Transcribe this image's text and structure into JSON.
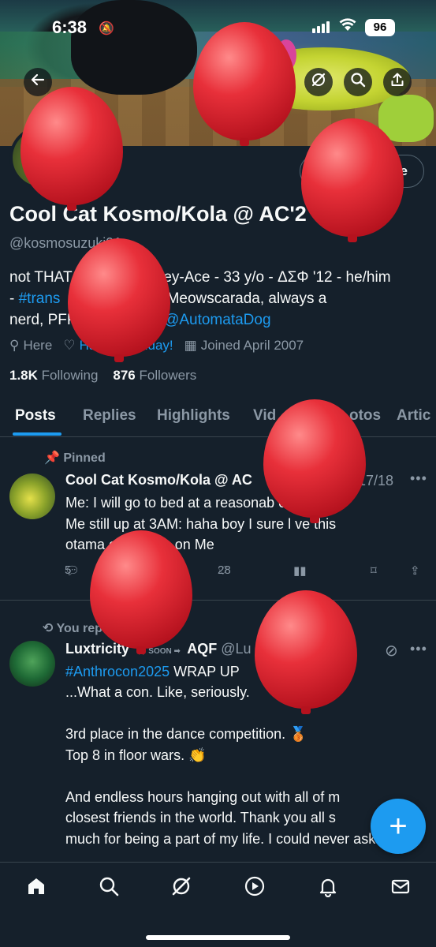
{
  "status_bar": {
    "time": "6:38",
    "battery": "96"
  },
  "header": {},
  "profile": {
    "edit_button_partial": "e",
    "name": "Cool Cat Kosmo/Kola @ AC'2",
    "handle": "@kosmosuzuki91",
    "bio_line1": "not THAT                  Grey-Ace - 33 y/o - ΔΣΦ '12 - he/him",
    "bio_line2_a": "- ",
    "bio_line2_link": "#trans",
    "bio_line2_b": "              imes a Meowscarada, always a",
    "bio_line3_a": "nerd, PFP                   : ",
    "bio_line3_link": "@AutomataDog",
    "location": "Here",
    "website": "Happy birthday!",
    "joined": "Joined April 2007",
    "following_count": "1.8K",
    "following_label": "Following",
    "followers_count": "876",
    "followers_label": "Followers"
  },
  "tabs": [
    "Posts",
    "Replies",
    "Highlights",
    "Vid",
    "otos",
    "Artic"
  ],
  "posts": [
    {
      "pinned_label": "Pinned",
      "author": "Cool Cat Kosmo/Kola @ AC",
      "date": "17/18",
      "text": "Me: I will go to bed at a reasonab        e.\nMe still up at 3AM: haha boy I sure l  ve this\notama            er of Take on Me",
      "reply_count": "5",
      "like_count": "28"
    },
    {
      "reposted_label": "You rep",
      "author": "Luxtricity",
      "author_suffix": "AQF",
      "handle": "@Lu",
      "soon_badge": "SOON",
      "hashtag": "#Anthrocon2025",
      "text_after_hashtag": " WRAP UP",
      "body": "...What a con. Like, seriously.\n\n3rd place in the dance competition. 🥉\nTop 8 in floor wars. 👏\n\nAnd endless hours hanging out with all of m\nclosest friends in the world. Thank you all s\nmuch for being a part of my life. I could never ask"
    }
  ],
  "fab_label": "+",
  "icons": {
    "back": "arrow-left-icon",
    "grok": "grok-icon",
    "search": "search-icon",
    "share": "share-icon",
    "home": "home-icon",
    "notifications": "bell-icon",
    "messages": "mail-icon",
    "video": "play-icon"
  },
  "colors": {
    "accent": "#1d9bf0",
    "background": "#15202b",
    "muted": "#8b98a5",
    "balloon": "#e8303a"
  }
}
